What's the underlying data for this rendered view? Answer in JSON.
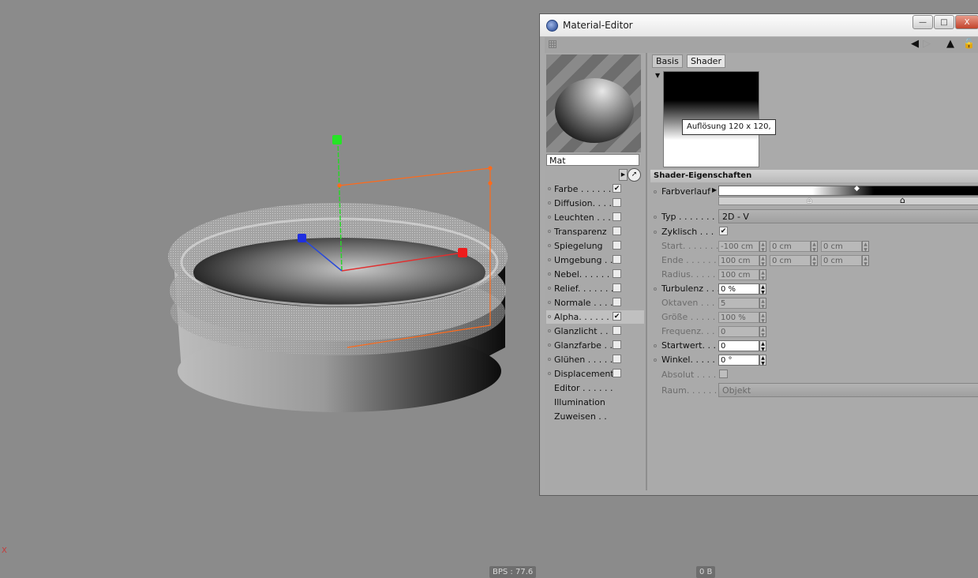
{
  "window": {
    "title": "Material-Editor",
    "controls": {
      "minimize": "—",
      "maximize": "□",
      "close": "X"
    }
  },
  "toolbar": {
    "icons": [
      "back-arrow-icon",
      "forward-arrow-icon",
      "up-arrow-icon",
      "lock-icon"
    ]
  },
  "material": {
    "name": "Mat"
  },
  "channels": [
    {
      "label": "Farbe . . . . . . .",
      "checked": true,
      "checkbox": true
    },
    {
      "label": "Diffusion. . . .",
      "checked": false,
      "checkbox": true
    },
    {
      "label": "Leuchten . . . .",
      "checked": false,
      "checkbox": true
    },
    {
      "label": "Transparenz",
      "checked": false,
      "checkbox": true
    },
    {
      "label": "Spiegelung",
      "checked": false,
      "checkbox": true
    },
    {
      "label": "Umgebung . .",
      "checked": false,
      "checkbox": true
    },
    {
      "label": "Nebel. . . . . . .",
      "checked": false,
      "checkbox": true
    },
    {
      "label": "Relief. . . . . . .",
      "checked": false,
      "checkbox": true
    },
    {
      "label": "Normale . . . .",
      "checked": false,
      "checkbox": true
    },
    {
      "label": "Alpha. . . . . . .",
      "checked": true,
      "checkbox": true,
      "selected": true
    },
    {
      "label": "Glanzlicht . .",
      "checked": false,
      "checkbox": true
    },
    {
      "label": "Glanzfarbe . .",
      "checked": false,
      "checkbox": true
    },
    {
      "label": "Glühen . . . . .",
      "checked": false,
      "checkbox": true
    },
    {
      "label": "Displacement",
      "checked": false,
      "checkbox": true
    },
    {
      "label": "Editor . . . . . .",
      "checkbox": false
    },
    {
      "label": "Illumination",
      "checkbox": false
    },
    {
      "label": "Zuweisen . .",
      "checkbox": false
    }
  ],
  "tabs": {
    "basis": "Basis",
    "shader": "Shader"
  },
  "preview": {
    "tooltip": "Auflösung 120 x 120,"
  },
  "shader": {
    "section_title": "Shader-Eigenschaften",
    "farbverlauf": "Farbverlauf",
    "typ": {
      "label": "Typ . . . . . . . . .",
      "value": "2D - V"
    },
    "zyklisch": {
      "label": "Zyklisch . . .",
      "checked": true
    },
    "start": {
      "label": "Start. . . . . . . .",
      "v1": "-100 cm",
      "v2": "0 cm",
      "v3": "0 cm"
    },
    "ende": {
      "label": "Ende . . . . . . .",
      "v1": "100 cm",
      "v2": "0 cm",
      "v3": "0 cm"
    },
    "radius": {
      "label": "Radius. . . . . .",
      "value": "100 cm"
    },
    "turbulenz": {
      "label": "Turbulenz . . .",
      "value": "0 %"
    },
    "oktaven": {
      "label": "Oktaven . . . .",
      "value": "5"
    },
    "groesse": {
      "label": "Größe . . . . . .",
      "value": "100 %"
    },
    "frequenz": {
      "label": "Frequenz. . . .",
      "value": "0"
    },
    "startwert": {
      "label": "Startwert. . . .",
      "value": "0"
    },
    "winkel": {
      "label": "Winkel. . . . . .",
      "value": "0 °"
    },
    "absolut": {
      "label": "Absolut . . . .",
      "checked": false
    },
    "raum": {
      "label": "Raum. . . . . . .",
      "value": "Objekt"
    }
  },
  "status": {
    "bps": "BPS : 77.6",
    "mem": "0 B",
    "axis": "X"
  }
}
